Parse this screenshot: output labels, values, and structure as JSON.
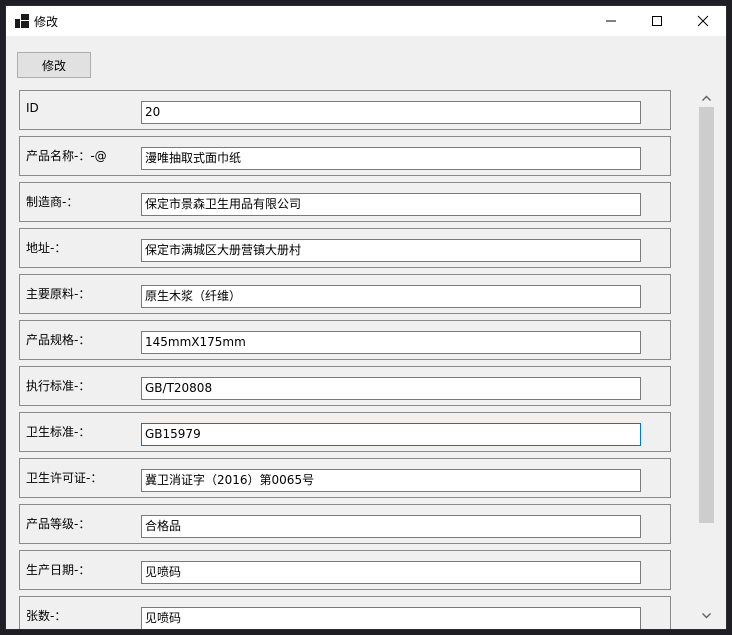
{
  "window": {
    "title": "修改"
  },
  "toolbar": {
    "modify_label": "修改"
  },
  "icons": {
    "app": "app-icon",
    "minimize": "minimize-icon",
    "maximize": "maximize-icon",
    "close": "close-icon",
    "scroll_up": "chevron-up-icon",
    "scroll_down": "chevron-down-icon"
  },
  "colors": {
    "focus_border": "#0078d7",
    "window_bg": "#f0f0f0"
  },
  "fields": [
    {
      "label": "ID",
      "value": "20"
    },
    {
      "label": "产品名称-：-@",
      "value": "漫唯抽取式面巾纸"
    },
    {
      "label": "制造商-：",
      "value": "保定市景森卫生用品有限公司"
    },
    {
      "label": "地址-：",
      "value": "保定市满城区大册营镇大册村"
    },
    {
      "label": "主要原料-：",
      "value": "原生木浆（纤维）"
    },
    {
      "label": "产品规格-：",
      "value": "145mmX175mm"
    },
    {
      "label": "执行标准-：",
      "value": "GB/T20808"
    },
    {
      "label": "卫生标准-：",
      "value": "GB15979"
    },
    {
      "label": "卫生许可证-：",
      "value": "冀卫消证字（2016）第0065号"
    },
    {
      "label": "产品等级-：",
      "value": "合格品"
    },
    {
      "label": "生产日期-：",
      "value": "见喷码"
    },
    {
      "label": "张数-：",
      "value": "见喷码"
    }
  ]
}
